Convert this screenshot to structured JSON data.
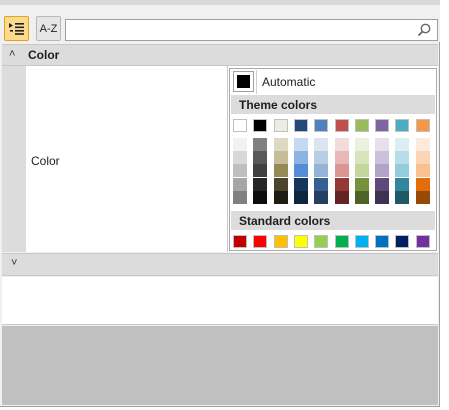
{
  "toolbar": {
    "categorized_icon": "categorized-view-icon",
    "az_label": "A-Z",
    "search_placeholder": "",
    "search_icon": "search-icon"
  },
  "category": {
    "expanded_chevron": "˄",
    "title": "Color",
    "property_name": "Color"
  },
  "color_picker": {
    "automatic_label": "Automatic",
    "automatic_color": "#000000",
    "theme_header": "Theme colors",
    "standard_header": "Standard colors",
    "theme_top": [
      "#ffffff",
      "#000000",
      "#eeece1",
      "#1f497d",
      "#4f81bd",
      "#c0504d",
      "#9bbb59",
      "#8064a2",
      "#4bacc6",
      "#f79646"
    ],
    "theme_shades": [
      [
        "#f2f2f2",
        "#d9d9d9",
        "#bfbfbf",
        "#a6a6a6",
        "#808080"
      ],
      [
        "#808080",
        "#595959",
        "#404040",
        "#262626",
        "#0d0d0d"
      ],
      [
        "#ddd9c3",
        "#c4bd97",
        "#948a54",
        "#4a452a",
        "#1e1c11"
      ],
      [
        "#c6d9f1",
        "#8db3e2",
        "#548dd4",
        "#17365d",
        "#0f243e"
      ],
      [
        "#dbe5f1",
        "#b8cce4",
        "#95b3d7",
        "#366092",
        "#244061"
      ],
      [
        "#f2dcdb",
        "#e6b9b8",
        "#d99694",
        "#953734",
        "#632423"
      ],
      [
        "#ebf1de",
        "#d7e4bd",
        "#c3d69b",
        "#76923c",
        "#4f6228"
      ],
      [
        "#e5e0ec",
        "#ccc1da",
        "#b3a2c7",
        "#5f497a",
        "#3f3151"
      ],
      [
        "#dbeef4",
        "#b7dee8",
        "#93cddd",
        "#31859c",
        "#205867"
      ],
      [
        "#fdeada",
        "#fbd5b5",
        "#fac08f",
        "#e46c0a",
        "#984807"
      ]
    ],
    "standard": [
      "#c00000",
      "#ff0000",
      "#ffc000",
      "#ffff00",
      "#92d050",
      "#00b050",
      "#00b0f0",
      "#0070c0",
      "#002060",
      "#7030a0"
    ]
  },
  "category2": {
    "collapsed_chevron": "˅"
  }
}
